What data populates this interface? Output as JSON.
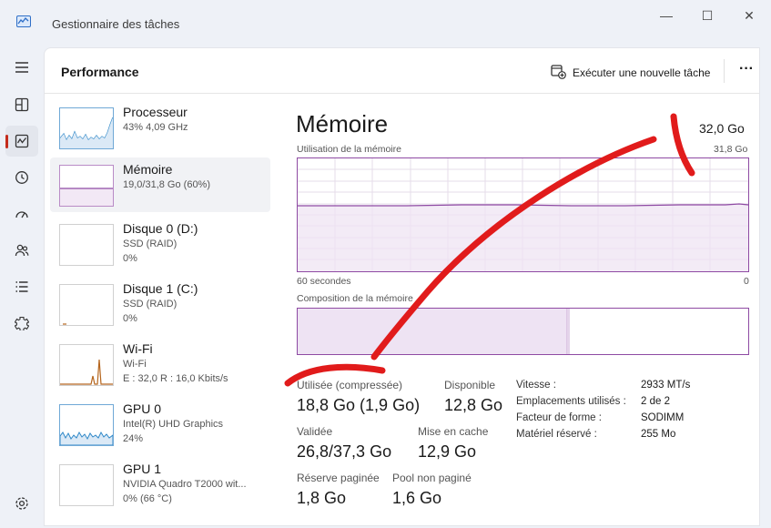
{
  "window": {
    "title": "Gestionnaire des tâches",
    "controls": {
      "minimize": "—",
      "maximize": "☐",
      "close": "✕"
    }
  },
  "nav": {
    "items": [
      {
        "icon": "hamburger-menu-icon"
      },
      {
        "icon": "processes-icon"
      },
      {
        "icon": "performance-icon",
        "active": true
      },
      {
        "icon": "app-history-icon"
      },
      {
        "icon": "startup-apps-icon"
      },
      {
        "icon": "users-icon"
      },
      {
        "icon": "details-icon"
      },
      {
        "icon": "services-icon"
      },
      {
        "icon": "settings-icon"
      }
    ]
  },
  "header": {
    "title": "Performance",
    "run_task": "Exécuter une nouvelle tâche",
    "more": "···"
  },
  "devices": [
    {
      "name": "Processeur",
      "line1": "43% 4,09 GHz",
      "line2": ""
    },
    {
      "name": "Mémoire",
      "line1": "19,0/31,8 Go (60%)",
      "line2": "",
      "active": true
    },
    {
      "name": "Disque 0 (D:)",
      "line1": "SSD (RAID)",
      "line2": "0%"
    },
    {
      "name": "Disque 1 (C:)",
      "line1": "SSD (RAID)",
      "line2": "0%"
    },
    {
      "name": "Wi-Fi",
      "line1": "Wi-Fi",
      "line2": "E : 32,0 R : 16,0 Kbits/s"
    },
    {
      "name": "GPU 0",
      "line1": "Intel(R) UHD Graphics",
      "line2": "24%"
    },
    {
      "name": "GPU 1",
      "line1": "NVIDIA Quadro T2000 wit...",
      "line2": "0% (66 °C)"
    }
  ],
  "memory": {
    "title": "Mémoire",
    "total": "32,0 Go",
    "usage_label": "Utilisation de la mémoire",
    "usage_max": "31,8 Go",
    "time_left": "60 secondes",
    "time_right": "0",
    "usage_fraction": 0.6,
    "composition_label": "Composition de la mémoire",
    "composition_used_fraction": 0.6,
    "stats": {
      "used_label": "Utilisée (compressée)",
      "used_value": "18,8 Go (1,9 Go)",
      "available_label": "Disponible",
      "available_value": "12,8 Go",
      "committed_label": "Validée",
      "committed_value": "26,8/37,3 Go",
      "cached_label": "Mise en cache",
      "cached_value": "12,9 Go",
      "paged_label": "Réserve paginée",
      "paged_value": "1,8 Go",
      "nonpaged_label": "Pool non paginé",
      "nonpaged_value": "1,6 Go"
    },
    "details": {
      "speed_label": "Vitesse :",
      "speed_value": "2933 MT/s",
      "slots_label": "Emplacements utilisés :",
      "slots_value": "2 de 2",
      "form_label": "Facteur de forme :",
      "form_value": "SODIMM",
      "reserved_label": "Matériel réservé :",
      "reserved_value": "255 Mo"
    }
  },
  "colors": {
    "accent_memory": "#8e4aa3",
    "accent_cpu": "#2f88c8",
    "accent_wifi": "#b5651d",
    "annotation": "#e11b1b"
  }
}
